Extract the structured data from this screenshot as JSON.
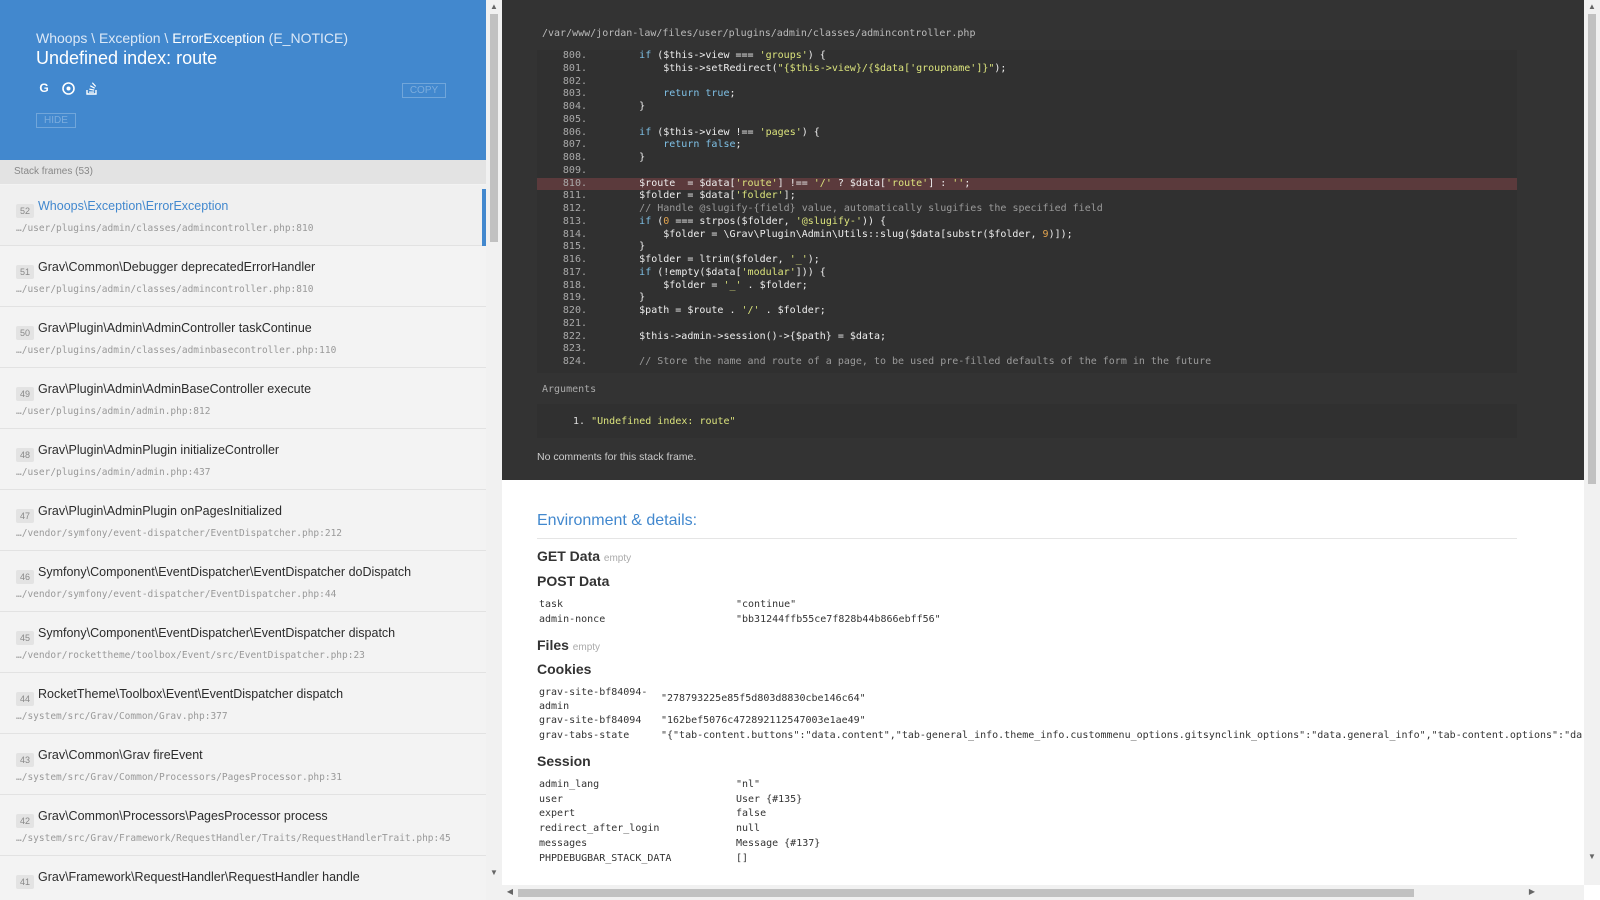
{
  "header": {
    "exception_path": "Whoops \\ Exception \\ ",
    "exception_class": "ErrorException",
    "exception_code": " (E_NOTICE)",
    "message": "Undefined index: route",
    "copy_label": "COPY",
    "hide_label": "HIDE",
    "search_icons": [
      "google-icon",
      "duckduckgo-icon",
      "stackoverflow-icon"
    ]
  },
  "frames_heading": "Stack frames (53)",
  "frames": [
    {
      "index": "52",
      "title": "Whoops\\Exception\\ErrorException",
      "file": "…/user/plugins/admin/classes/admincontroller.php:810"
    },
    {
      "index": "51",
      "title": "Grav\\Common\\Debugger deprecatedErrorHandler",
      "file": "…/user/plugins/admin/classes/admincontroller.php:810"
    },
    {
      "index": "50",
      "title": "Grav\\Plugin\\Admin\\AdminController taskContinue",
      "file": "…/user/plugins/admin/classes/adminbasecontroller.php:110"
    },
    {
      "index": "49",
      "title": "Grav\\Plugin\\Admin\\AdminBaseController execute",
      "file": "…/user/plugins/admin/admin.php:812"
    },
    {
      "index": "48",
      "title": "Grav\\Plugin\\AdminPlugin initializeController",
      "file": "…/user/plugins/admin/admin.php:437"
    },
    {
      "index": "47",
      "title": "Grav\\Plugin\\AdminPlugin onPagesInitialized",
      "file": "…/vendor/symfony/event-dispatcher/EventDispatcher.php:212"
    },
    {
      "index": "46",
      "title": "Symfony\\Component\\EventDispatcher\\EventDispatcher doDispatch",
      "file": "…/vendor/symfony/event-dispatcher/EventDispatcher.php:44"
    },
    {
      "index": "45",
      "title": "Symfony\\Component\\EventDispatcher\\EventDispatcher dispatch",
      "file": "…/vendor/rockettheme/toolbox/Event/src/EventDispatcher.php:23"
    },
    {
      "index": "44",
      "title": "RocketTheme\\Toolbox\\Event\\EventDispatcher dispatch",
      "file": "…/system/src/Grav/Common/Grav.php:377"
    },
    {
      "index": "43",
      "title": "Grav\\Common\\Grav fireEvent",
      "file": "…/system/src/Grav/Common/Processors/PagesProcessor.php:31"
    },
    {
      "index": "42",
      "title": "Grav\\Common\\Processors\\PagesProcessor process",
      "file": "…/system/src/Grav/Framework/RequestHandler/Traits/RequestHandlerTrait.php:45"
    },
    {
      "index": "41",
      "title": "Grav\\Framework\\RequestHandler\\RequestHandler handle",
      "file": ""
    }
  ],
  "code": {
    "file_path": "/var/www/jordan-law/files/user/plugins/admin/classes/admincontroller.php",
    "highlight_line": "810.",
    "lines": [
      {
        "no": "800.",
        "html": "        <span class=\"k\">if</span> ($this->view === <span class=\"s\">'groups'</span>) {"
      },
      {
        "no": "801.",
        "html": "            $this->setRedirect(<span class=\"s\">\"{$this->view}/{$data['groupname']}\"</span>);"
      },
      {
        "no": "802.",
        "html": ""
      },
      {
        "no": "803.",
        "html": "            <span class=\"k\">return true</span>;"
      },
      {
        "no": "804.",
        "html": "        }"
      },
      {
        "no": "805.",
        "html": ""
      },
      {
        "no": "806.",
        "html": "        <span class=\"k\">if</span> ($this->view !== <span class=\"s\">'pages'</span>) {"
      },
      {
        "no": "807.",
        "html": "            <span class=\"k\">return false</span>;"
      },
      {
        "no": "808.",
        "html": "        }"
      },
      {
        "no": "809.",
        "html": ""
      },
      {
        "no": "810.",
        "html": "        $route  = $data[<span class=\"s\">'route'</span>] !== <span class=\"s\">'/'</span> ? $data[<span class=\"s\">'route'</span>] : <span class=\"s\">''</span>;"
      },
      {
        "no": "811.",
        "html": "        $folder = $data[<span class=\"s\">'folder'</span>];"
      },
      {
        "no": "812.",
        "html": "        <span class=\"c\">// Handle @slugify-{field} value, automatically slugifies the specified field</span>"
      },
      {
        "no": "813.",
        "html": "        <span class=\"k\">if</span> (<span class=\"n\">0</span> === strpos($folder, <span class=\"s\">'@slugify-'</span>)) {"
      },
      {
        "no": "814.",
        "html": "            $folder = \\Grav\\Plugin\\Admin\\Utils::slug($data[substr($folder, <span class=\"n\">9</span>)]);"
      },
      {
        "no": "815.",
        "html": "        }"
      },
      {
        "no": "816.",
        "html": "        $folder = ltrim($folder, <span class=\"s\">'_'</span>);"
      },
      {
        "no": "817.",
        "html": "        <span class=\"k\">if</span> (!empty($data[<span class=\"s\">'modular'</span>])) {"
      },
      {
        "no": "818.",
        "html": "            $folder = <span class=\"s\">'_'</span> . $folder;"
      },
      {
        "no": "819.",
        "html": "        }"
      },
      {
        "no": "820.",
        "html": "        $path = $route . <span class=\"s\">'/'</span> . $folder;"
      },
      {
        "no": "821.",
        "html": ""
      },
      {
        "no": "822.",
        "html": "        $this->admin->session()->{$path} = $data;"
      },
      {
        "no": "823.",
        "html": ""
      },
      {
        "no": "824.",
        "html": "        <span class=\"c\">// Store the name and route of a page, to be used pre-filled defaults of the form in the future</span>"
      }
    ]
  },
  "arguments_label": "Arguments",
  "arguments": [
    {
      "no": "1.",
      "value": "\"Undefined index: route\""
    }
  ],
  "no_comments": "No comments for this stack frame.",
  "details": {
    "title": "Environment & details:",
    "empty_label": "empty",
    "get_title": "GET Data",
    "post_title": "POST Data",
    "post": [
      {
        "key": "task",
        "value": "\"continue\""
      },
      {
        "key": "admin-nonce",
        "value": "\"bb31244ffb55ce7f828b44b866ebff56\""
      }
    ],
    "files_title": "Files",
    "cookies_title": "Cookies",
    "cookies": [
      {
        "key": "grav-site-bf84094-",
        "key2": "admin",
        "value": "\"278793225e85f5d803d8830cbe146c64\""
      },
      {
        "key": "grav-site-bf84094",
        "value": "\"162bef5076c472892112547003e1ae49\""
      },
      {
        "key": "grav-tabs-state",
        "value": "\"{\"tab-content.buttons\":\"data.content\",\"tab-general_info.theme_info.custommenu_options.gitsynclink_options\":\"data.general_info\",\"tab-content.options\":\"da"
      }
    ],
    "session_title": "Session",
    "session": [
      {
        "key": "admin_lang",
        "value": "\"nl\""
      },
      {
        "key": "user",
        "value": "User {#135}"
      },
      {
        "key": "expert",
        "value": "false"
      },
      {
        "key": "redirect_after_login",
        "value": "null"
      },
      {
        "key": "messages",
        "value": "Message {#137}"
      },
      {
        "key": "PHPDEBUGBAR_STACK_DATA",
        "value": "[]"
      }
    ]
  },
  "colors": {
    "accent": "#4288ce",
    "code_bg": "#333333",
    "highlight": "#5b3a3c"
  }
}
